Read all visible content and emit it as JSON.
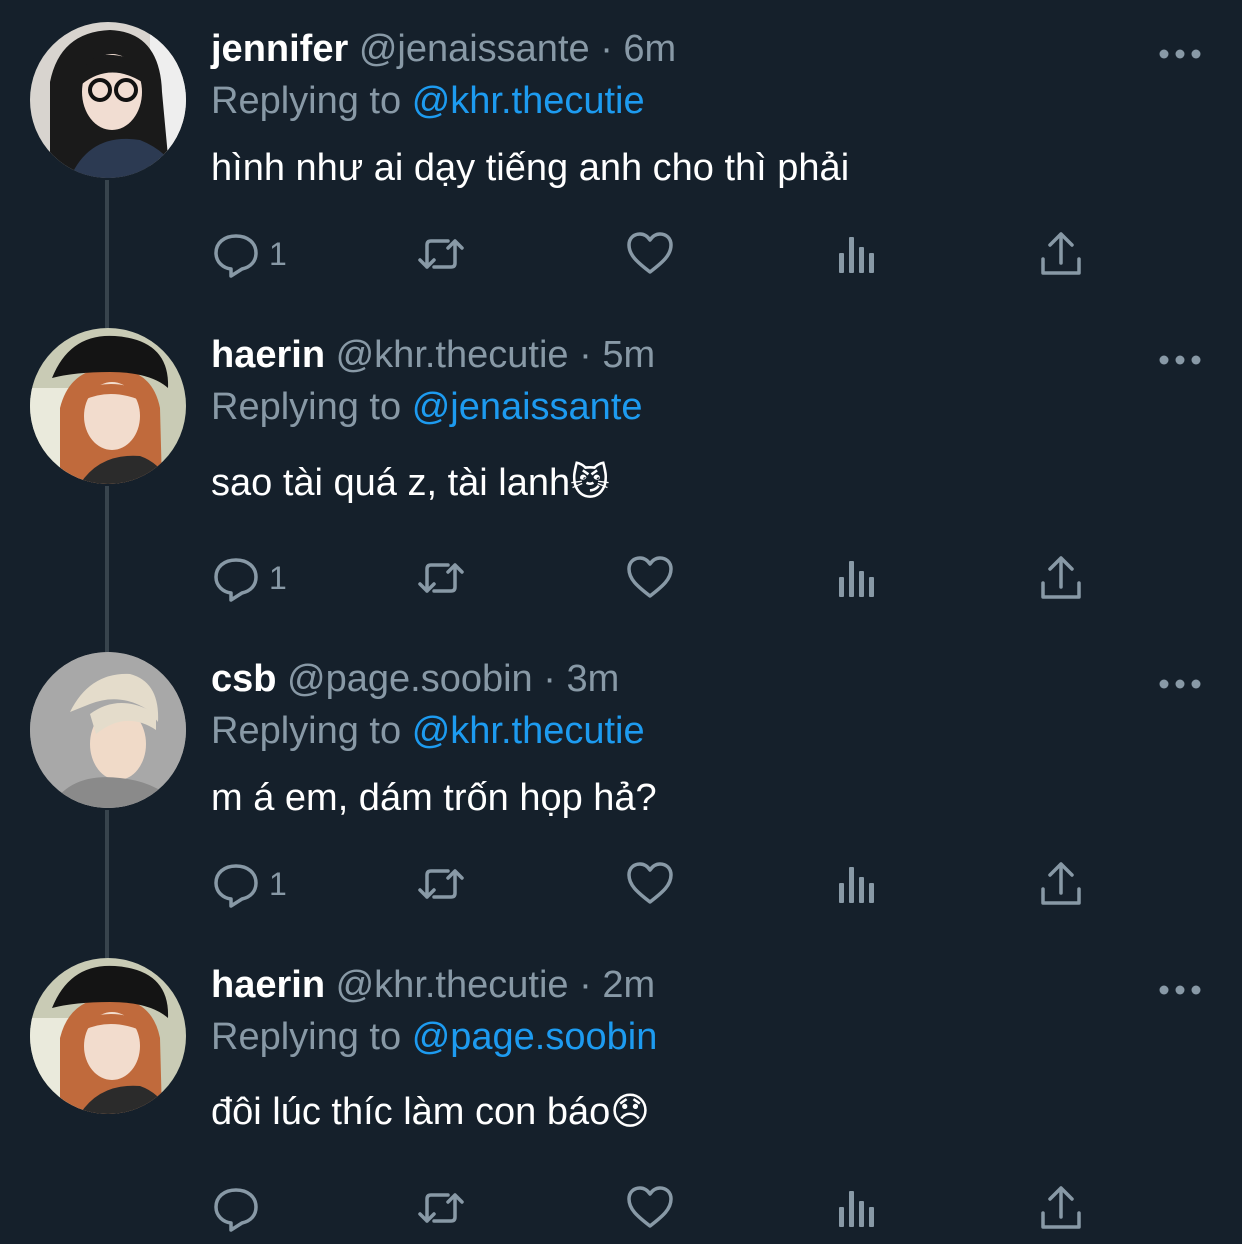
{
  "tweets": [
    {
      "display_name": "jennifer",
      "handle": "@jenaissante",
      "dot": "·",
      "time": "6m",
      "replying_label": "Replying to",
      "replying_to": "@khr.thecutie",
      "text": "hình như ai dạy tiếng anh cho thì phải",
      "reply_count": "1"
    },
    {
      "display_name": "haerin",
      "handle": "@khr.thecutie",
      "dot": "·",
      "time": "5m",
      "replying_label": "Replying to",
      "replying_to": "@jenaissante",
      "text": "sao tài quá z, tài lanh😼",
      "reply_count": "1"
    },
    {
      "display_name": "csb",
      "handle": "@page.soobin",
      "dot": "·",
      "time": "3m",
      "replying_label": "Replying to",
      "replying_to": "@khr.thecutie",
      "text": "m á em, dám trốn họp hả?",
      "reply_count": "1"
    },
    {
      "display_name": "haerin",
      "handle": "@khr.thecutie",
      "dot": "·",
      "time": "2m",
      "replying_label": "Replying to",
      "replying_to": "@page.soobin",
      "text": "đôi lúc thíc làm con báo😞",
      "reply_count": ""
    }
  ],
  "icons": {
    "reply": "reply-icon",
    "retweet": "retweet-icon",
    "like": "heart-icon",
    "analytics": "analytics-icon",
    "share": "share-icon",
    "more": "more-icon"
  },
  "colors": {
    "background": "#15202b",
    "text": "#ffffff",
    "secondary": "#8899a6",
    "mention": "#1d9bf0",
    "thread_line": "#38444d"
  }
}
